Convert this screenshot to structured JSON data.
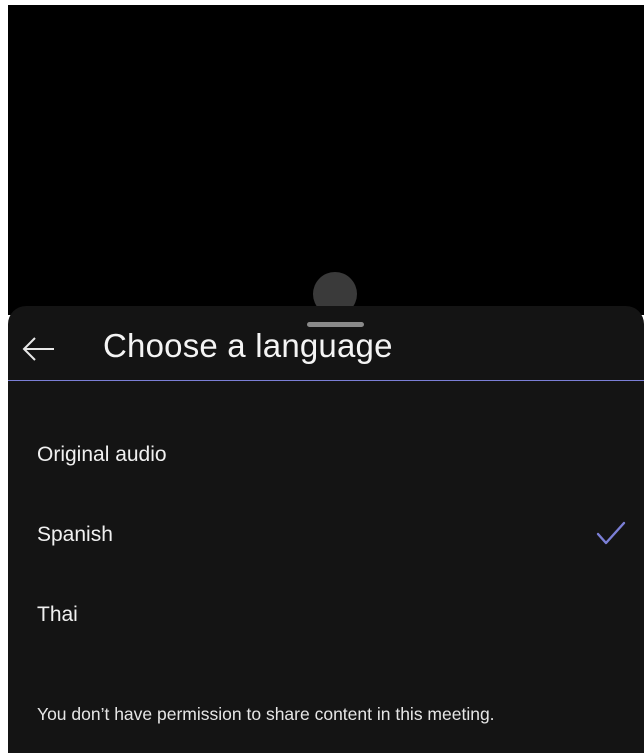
{
  "sheet": {
    "title": "Choose a language",
    "back_label": "Back"
  },
  "languages": [
    {
      "label": "Original audio",
      "selected": false
    },
    {
      "label": "Spanish",
      "selected": true
    },
    {
      "label": "Thai",
      "selected": false
    }
  ],
  "notice": "You don’t have permission to share content in this meeting.",
  "colors": {
    "accent": "#7b7fd6",
    "sheet_background": "#141414",
    "backdrop": "#000000",
    "text": "#f0f0f0"
  },
  "icons": {
    "back": "arrow-left-icon",
    "selected": "checkmark-icon"
  }
}
